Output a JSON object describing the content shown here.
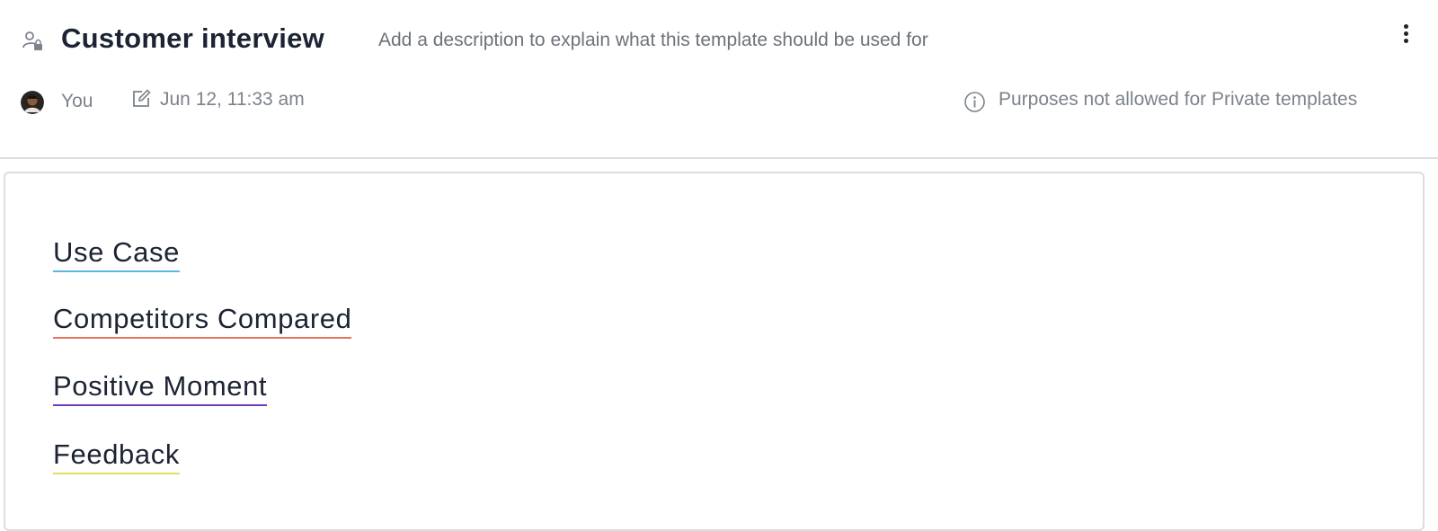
{
  "header": {
    "title": "Customer interview",
    "description_placeholder": "Add a description to explain what this template should be used for",
    "author": "You",
    "timestamp": "Jun 12, 11:33 am",
    "purpose_note": "Purposes not allowed for Private templates",
    "icons": {
      "privacy": "private-user-lock-icon",
      "edit": "edit-icon",
      "info": "info-icon",
      "menu": "kebab-menu-icon"
    }
  },
  "sections": [
    {
      "label": "Use Case",
      "color": "#5db6e6"
    },
    {
      "label": "Competitors Compared",
      "color": "#e9735a"
    },
    {
      "label": "Positive Moment",
      "color": "#6a3fb7"
    },
    {
      "label": "Feedback",
      "color": "#e5dd5e"
    }
  ]
}
